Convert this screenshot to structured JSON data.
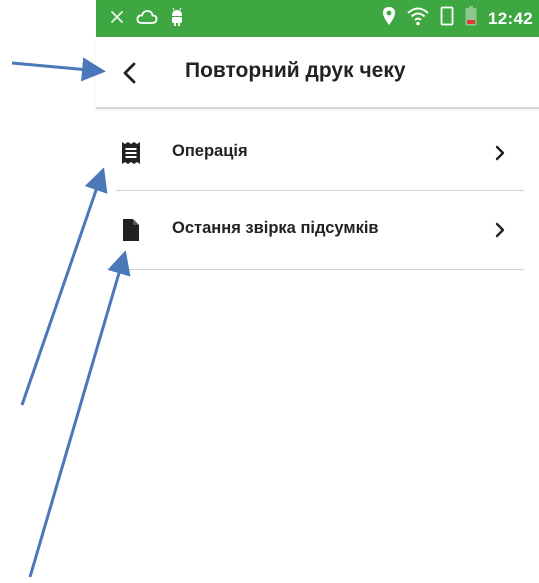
{
  "status_bar": {
    "time": "12:42",
    "left_icons": [
      "close-icon",
      "cloud-icon",
      "android-icon"
    ],
    "right_icons": [
      "location-icon",
      "wifi-icon",
      "sim-icon",
      "battery-icon"
    ],
    "color": "#3ea742"
  },
  "app_bar": {
    "title": "Повторний друк чеку",
    "back_icon": "chevron-left-icon"
  },
  "menu": {
    "items": [
      {
        "label": "Операція",
        "icon": "receipt-icon"
      },
      {
        "label": "Остання звірка підсумків",
        "icon": "document-icon"
      }
    ]
  },
  "annotations": {
    "arrow_color": "#4a78b8",
    "arrows": [
      "arrow-to-back-button",
      "arrow-to-receipt-icon",
      "arrow-to-document-icon"
    ]
  }
}
